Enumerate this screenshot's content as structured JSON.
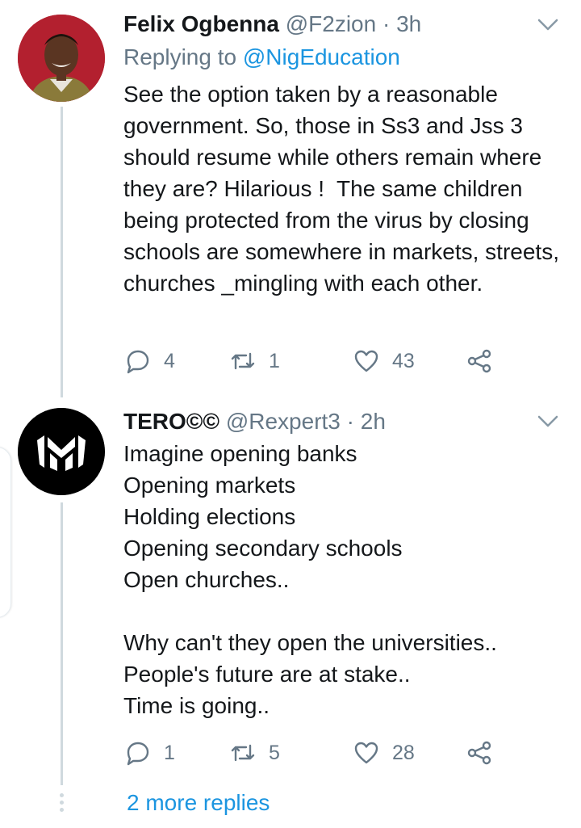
{
  "tweets": [
    {
      "name": "Felix Ogbenna",
      "handle": "@F2zion",
      "separator": "·",
      "time": "3h",
      "replying_prefix": "Replying to ",
      "replying_to": "@NigEducation",
      "text": "See the option taken by a reasonable government. So, those in Ss3 and Jss 3 should resume while others remain where they are? Hilarious !  The same children being protected from the virus by closing schools are somewhere in markets, streets, churches _mingling with each other.",
      "replies": "4",
      "retweets": "1",
      "likes": "43",
      "avatar_icon": "profile-photo"
    },
    {
      "name": "TERO©©",
      "handle": "@Rexpert3",
      "separator": "·",
      "time": "2h",
      "text": "Imagine opening banks\nOpening markets\nHolding elections\nOpening secondary schools\nOpen churches..\n\nWhy can't they open the universities..\nPeople's future are at stake..\nTime is going..",
      "replies": "1",
      "retweets": "5",
      "likes": "28",
      "avatar_icon": "logo-avatar"
    }
  ],
  "more_replies": "2 more replies",
  "colors": {
    "text": "#14171a",
    "secondary": "#657786",
    "link": "#1b95e0",
    "thread_line": "#cfd9de"
  }
}
